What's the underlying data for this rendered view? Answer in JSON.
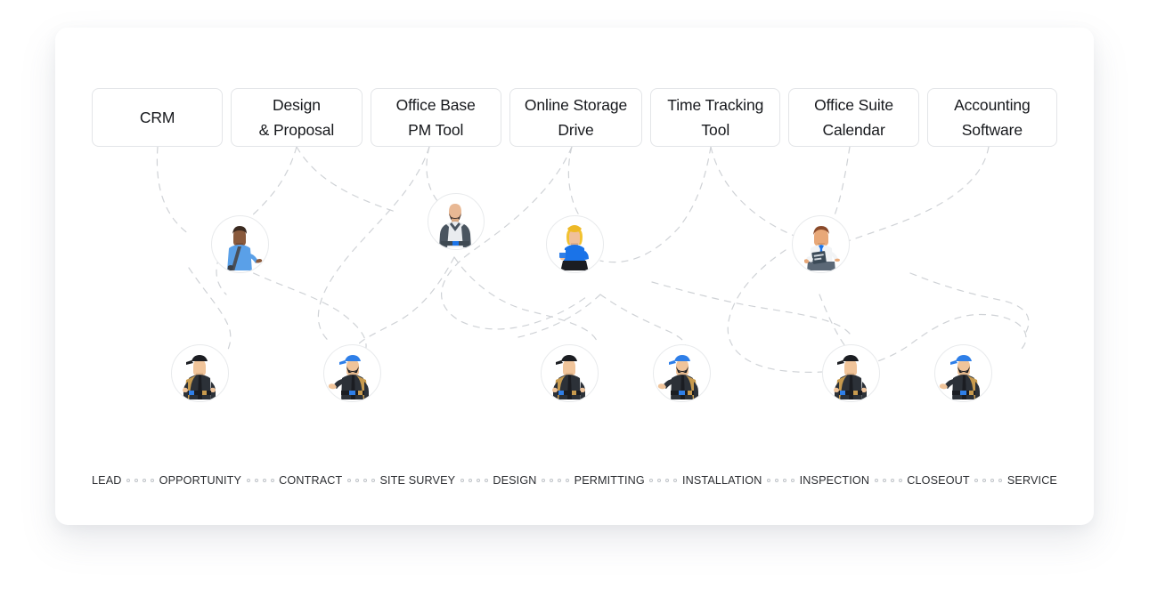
{
  "panel": {
    "background_color": "#ffffff",
    "accent_color": "#1a73e8",
    "line_color": "#cfd2d6"
  },
  "tool_cards": [
    {
      "name": "crm",
      "line1": "CRM",
      "line2": ""
    },
    {
      "name": "design",
      "line1": "Design",
      "line2": "& Proposal"
    },
    {
      "name": "pm-tool",
      "line1": "Office Base",
      "line2": "PM Tool"
    },
    {
      "name": "storage",
      "line1": "Online Storage",
      "line2": "Drive"
    },
    {
      "name": "time",
      "line1": "Time Tracking",
      "line2": "Tool"
    },
    {
      "name": "suite",
      "line1": "Office Suite",
      "line2": "Calendar"
    },
    {
      "name": "accounting",
      "line1": "Accounting",
      "line2": "Software"
    }
  ],
  "people": [
    {
      "name": "sales-rep-blue-shirt",
      "role": "office",
      "icon": "person-blue-shirt-bag-icon"
    },
    {
      "name": "manager-bald-blazer",
      "role": "office",
      "icon": "person-bald-beard-blazer-icon"
    },
    {
      "name": "coordinator-woman",
      "role": "office",
      "icon": "person-blonde-woman-cup-icon"
    },
    {
      "name": "inspector-clipboard",
      "role": "office",
      "icon": "person-white-shirt-clipboard-icon"
    },
    {
      "name": "technician-1",
      "role": "field",
      "icon": "worker-black-cap-icon"
    },
    {
      "name": "technician-2",
      "role": "field",
      "icon": "worker-blue-cap-waving-icon"
    },
    {
      "name": "technician-3",
      "role": "field",
      "icon": "worker-black-cap-icon"
    },
    {
      "name": "technician-4",
      "role": "field",
      "icon": "worker-blue-cap-waving-icon"
    },
    {
      "name": "technician-5",
      "role": "field",
      "icon": "worker-black-cap-icon"
    },
    {
      "name": "technician-6",
      "role": "field",
      "icon": "worker-blue-cap-waving-icon"
    }
  ],
  "timeline": {
    "stages": [
      "LEAD",
      "OPPORTUNITY",
      "CONTRACT",
      "SITE SURVEY",
      "DESIGN",
      "PERMITTING",
      "INSTALLATION",
      "INSPECTION",
      "CLOSEOUT",
      "SERVICE"
    ],
    "separator_dot_count": 4
  }
}
